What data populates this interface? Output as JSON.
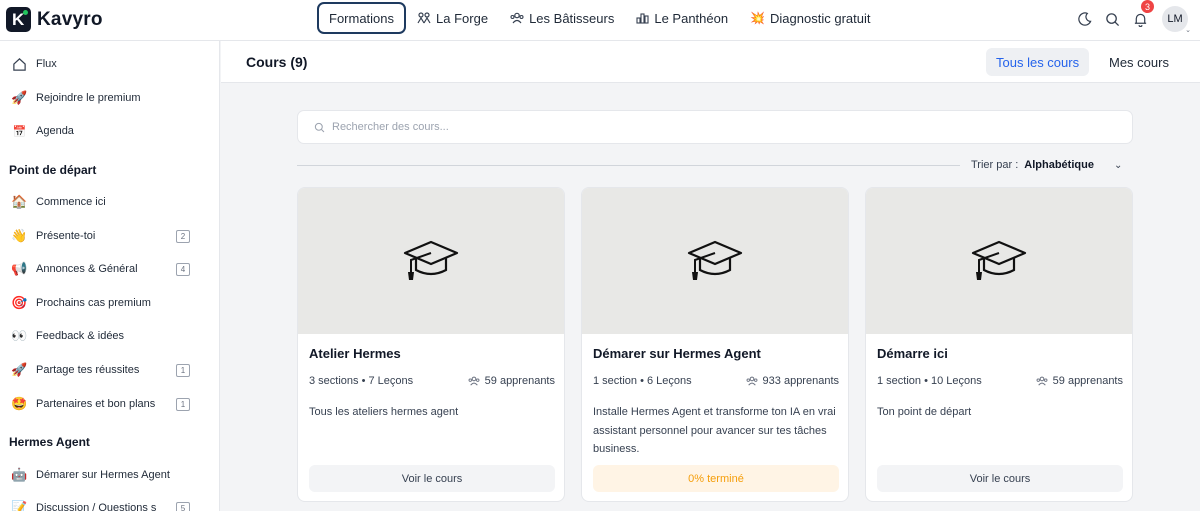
{
  "brand": {
    "name": "Kavyro",
    "logo_letter": "K"
  },
  "topnav": [
    {
      "label": "Formations",
      "icon": "",
      "active": true
    },
    {
      "label": "La Forge",
      "icon": "people-icon"
    },
    {
      "label": "Les Bâtisseurs",
      "icon": "group-icon"
    },
    {
      "label": "Le Panthéon",
      "icon": "bar-chart-icon"
    },
    {
      "label": "Diagnostic gratuit",
      "icon": "sparkle-icon"
    }
  ],
  "header_right": {
    "notifications_count": "3",
    "avatar_initials": "LM"
  },
  "sidebar": {
    "top_items": [
      {
        "label": "Flux",
        "icon": "home-icon"
      },
      {
        "label": "Rejoindre le premium",
        "icon": "rocket-icon"
      },
      {
        "label": "Agenda",
        "icon": "calendar-icon"
      }
    ],
    "section1": {
      "title": "Point de départ",
      "items": [
        {
          "label": "Commence ici",
          "icon": "house-icon",
          "count": ""
        },
        {
          "label": "Présente-toi",
          "icon": "wave-icon",
          "count": "2"
        },
        {
          "label": "Annonces & Général",
          "icon": "megaphone-icon",
          "count": "4"
        },
        {
          "label": "Prochains cas premium",
          "icon": "target-icon",
          "count": ""
        },
        {
          "label": "Feedback & idées",
          "icon": "eyes-icon",
          "count": ""
        },
        {
          "label": "Partage tes réussites",
          "icon": "rocket-icon",
          "count": "1"
        },
        {
          "label": "Partenaires et bon plans",
          "icon": "star-face-icon",
          "count": "1"
        }
      ]
    },
    "section2": {
      "title": "Hermes Agent",
      "items": [
        {
          "label": "Démarer sur Hermes Agent",
          "icon": "robot-icon",
          "count": ""
        },
        {
          "label": "Discussion / Questions s",
          "icon": "memo-icon",
          "count": "5"
        }
      ]
    }
  },
  "main": {
    "title": "Cours (9)",
    "tabs": {
      "all": "Tous les cours",
      "mine": "Mes cours"
    },
    "search_placeholder": "Rechercher des cours...",
    "sort": {
      "label": "Trier par :",
      "value": "Alphabétique"
    }
  },
  "courses": [
    {
      "title": "Atelier Hermes",
      "meta": "3 sections • 7 Leçons",
      "learners": "59 apprenants",
      "description": "Tous les ateliers hermes agent",
      "button": "Voir le cours",
      "progress": false
    },
    {
      "title": "Démarer sur Hermes Agent",
      "meta": "1 section • 6 Leçons",
      "learners": "933 apprenants",
      "description": "Installe Hermes Agent et transforme ton IA en vrai assistant personnel pour avancer sur tes tâches business.",
      "button": "0% terminé",
      "progress": true
    },
    {
      "title": "Démarre ici",
      "meta": "1 section • 10 Leçons",
      "learners": "59 apprenants",
      "description": "Ton point de départ",
      "button": "Voir le cours",
      "progress": false
    }
  ],
  "colors": {
    "accent": "#2563eb",
    "active_border": "#1e3a5f",
    "progress": "#f59e0b",
    "notification": "#ef4444"
  }
}
